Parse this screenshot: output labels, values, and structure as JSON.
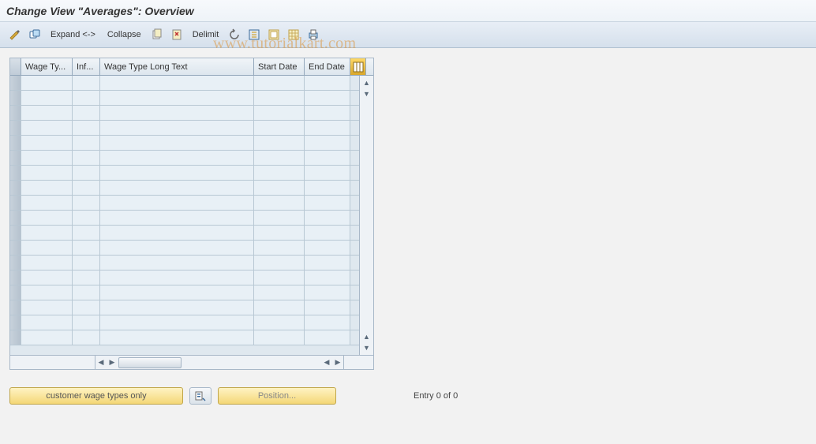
{
  "title": "Change View \"Averages\": Overview",
  "toolbar": {
    "expand": "Expand <->",
    "collapse": "Collapse",
    "delimit": "Delimit"
  },
  "watermark": "www.tutorialkart.com",
  "columns": {
    "sel": "",
    "wage_type": "Wage Ty...",
    "inf": "Inf...",
    "long_text": "Wage Type Long Text",
    "start_date": "Start Date",
    "end_date": "End Date"
  },
  "footer": {
    "customer_only": "customer wage types only",
    "position": "Position...",
    "entry": "Entry 0 of 0"
  }
}
